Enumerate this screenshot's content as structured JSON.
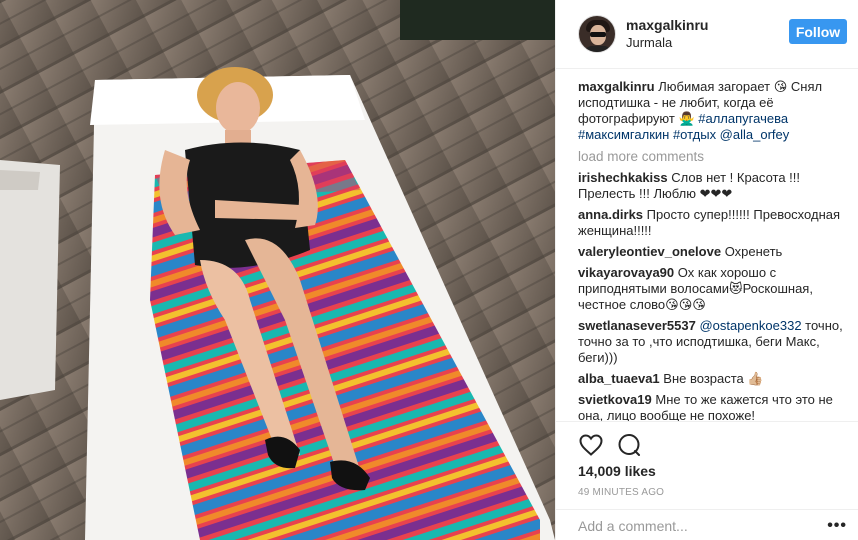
{
  "post": {
    "username": "maxgalkinru",
    "location": "Jurmala",
    "follow_label": "Follow"
  },
  "caption": {
    "user": "maxgalkinru",
    "text": "Любимая загорает 😘 Снял исподтишка - не любит, когда её фотографируют 🙅‍♂️",
    "hashtags": "#аллапугачева #максимгалкин #отдых @alla_orfey"
  },
  "load_more": "load more comments",
  "comments": [
    {
      "user": "irishechkakiss",
      "text": "Слов нет ! Красота !!! Прелесть !!! Люблю ❤❤❤"
    },
    {
      "user": "anna.dirks",
      "text": "Просто супер!!!!!! Превосходная женщина!!!!!"
    },
    {
      "user": "valeryleontiev_onelove",
      "text": "Охренеть"
    },
    {
      "user": "vikayarovaya90",
      "text": "Ох как хорошо с приподнятыми волосами😻Роскошная, честное слово😘😘😘"
    },
    {
      "user": "swetlanasever5537",
      "mention": "@ostapenkoe332",
      "text": "точно, точно за то ,что исподтишка, беги Макс, беги)))"
    },
    {
      "user": "alba_tuaeva1",
      "text": "Вне возраста 👍🏼"
    },
    {
      "user": "svietkova19",
      "text": "Мне то же кажется что это не она, лицо вообще не похоже!"
    }
  ],
  "stats": {
    "likes": "14,009 likes",
    "time": "49 MINUTES AGO"
  },
  "add_comment": {
    "placeholder": "Add a comment...",
    "more": "•••"
  },
  "icons": {
    "like": "heart-icon",
    "comment": "comment-bubble-icon",
    "more": "ellipsis-icon"
  },
  "colors": {
    "follow_button": "#3897f0",
    "hashtag": "#003569",
    "muted": "#999999"
  }
}
